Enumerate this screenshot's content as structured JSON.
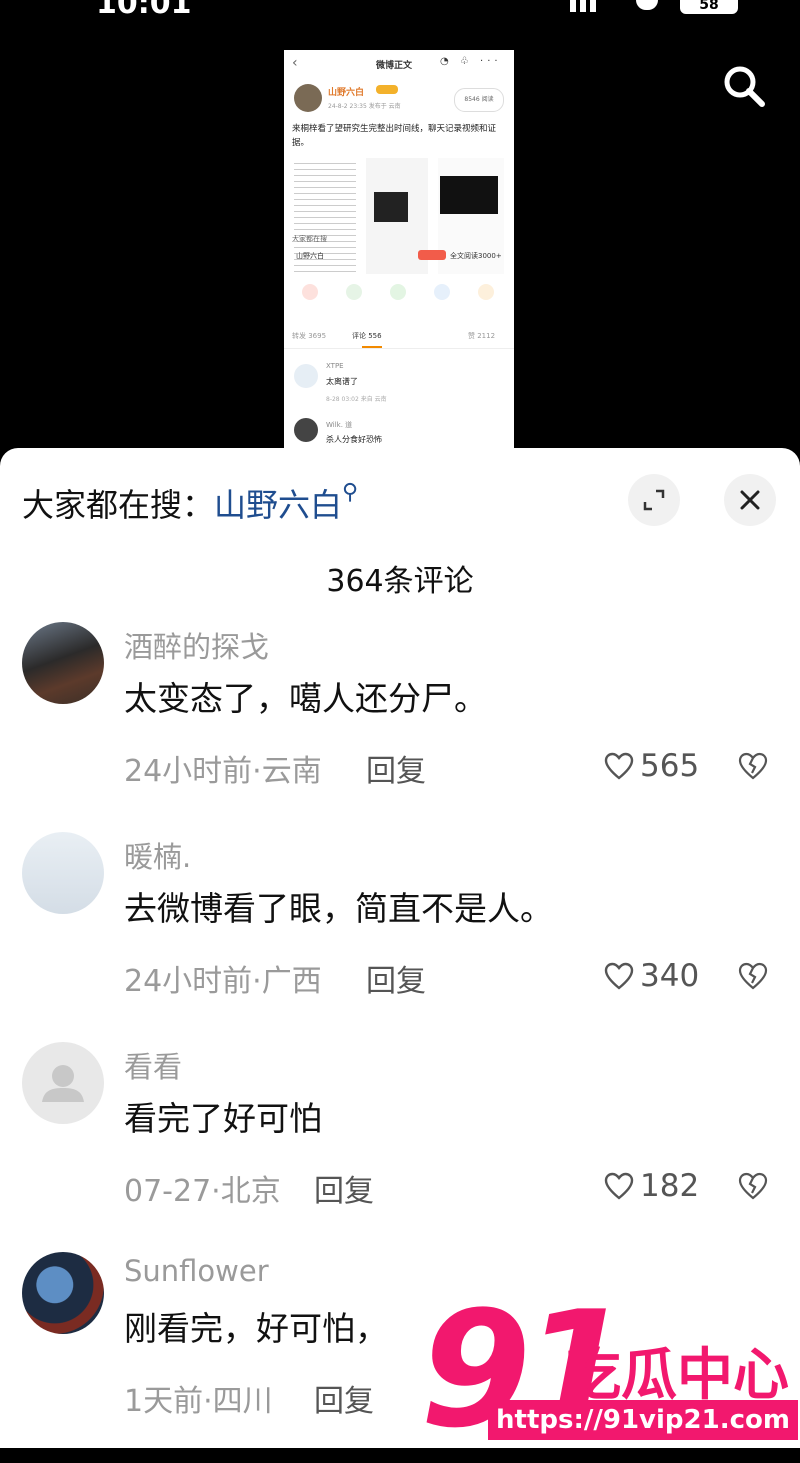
{
  "status_bar": {
    "time": "10:01",
    "battery": "58"
  },
  "embedded_post": {
    "header_title": "微博正文",
    "username": "山野六白",
    "meta": "24-8-2 23:35  发布于 云南",
    "follow_label": "8546 阅读",
    "body_text": "来桐梓看了望研究生完整出时间线，聊天记录视频和证据。",
    "search_hint": "大家都在搜",
    "search_keyword": "山野六白",
    "search_count": "全文阅读3000+",
    "tabs": {
      "repost": "转发 3695",
      "comments": "评论 556",
      "likes": "赞 2112"
    },
    "comment1": {
      "name": "XTPE",
      "text": "太离谱了",
      "meta": "8-28 03:02  来自 云南"
    },
    "comment2": {
      "name": "Wilk. 道",
      "text": "杀人分食好恐怖"
    }
  },
  "sheet": {
    "search_label": "大家都在搜：",
    "search_keyword": "山野六白",
    "comment_count": "364条评论"
  },
  "comments": [
    {
      "name": "酒醉的探戈",
      "text": "太变态了，噶人还分尸。",
      "meta": "24小时前·云南",
      "reply": "回复",
      "likes": "565"
    },
    {
      "name": "暖楠.",
      "text": "去微博看了眼，简直不是人。",
      "meta": "24小时前·广西",
      "reply": "回复",
      "likes": "340"
    },
    {
      "name": "看看",
      "text": "看完了好可怕",
      "meta": "07-27·北京",
      "reply": "回复",
      "likes": "182"
    },
    {
      "name": "Sunflower",
      "text": "刚看完，好可怕，",
      "meta": "1天前·四川",
      "reply": "回复",
      "likes": ""
    }
  ],
  "watermark": {
    "number": "91",
    "text": "吃瓜中心",
    "url": "https://91vip21.com"
  },
  "colors": {
    "keyword_blue": "#1f4d8f",
    "watermark_pink": "#f2186e"
  }
}
